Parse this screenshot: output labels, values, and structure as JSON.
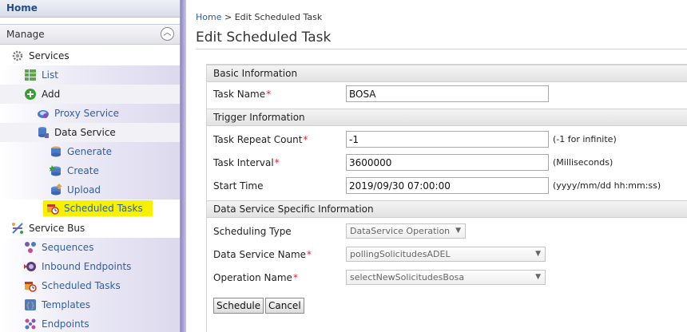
{
  "sidebar": {
    "home": "Home",
    "manage": "Manage",
    "collapse_glyph": "︿",
    "items": [
      {
        "label": "Services",
        "icon": "gear-icon"
      },
      {
        "label": "List",
        "icon": "list-grid-icon"
      },
      {
        "label": "Add",
        "icon": "plus-circle-icon"
      },
      {
        "label": "Proxy Service",
        "icon": "proxy-service-icon"
      },
      {
        "label": "Data Service",
        "icon": "database-icon"
      },
      {
        "label": "Generate",
        "icon": "generate-icon"
      },
      {
        "label": "Create",
        "icon": "create-icon"
      },
      {
        "label": "Upload",
        "icon": "upload-icon"
      },
      {
        "label": "Scheduled Tasks",
        "icon": "scheduled-task-icon"
      },
      {
        "label": "Service Bus",
        "icon": "service-bus-icon"
      },
      {
        "label": "Sequences",
        "icon": "sequences-icon"
      },
      {
        "label": "Inbound Endpoints",
        "icon": "inbound-endpoint-icon"
      },
      {
        "label": "Scheduled Tasks",
        "icon": "scheduled-task-icon"
      },
      {
        "label": "Templates",
        "icon": "templates-icon"
      },
      {
        "label": "Endpoints",
        "icon": "endpoints-icon"
      }
    ]
  },
  "breadcrumb": {
    "home": "Home",
    "separator": " > ",
    "current": "Edit Scheduled Task"
  },
  "page_title": "Edit Scheduled Task",
  "sections": {
    "basic": "Basic Information",
    "trigger": "Trigger Information",
    "ds": "Data Service Specific Information"
  },
  "fields": {
    "task_name": {
      "label": "Task Name",
      "required": "*",
      "value": "BOSA"
    },
    "repeat_count": {
      "label": "Task Repeat Count",
      "required": "*",
      "value": "-1",
      "hint": "(-1 for infinite)"
    },
    "interval": {
      "label": "Task Interval",
      "required": "*",
      "value": "3600000",
      "hint": "(Milliseconds)"
    },
    "start_time": {
      "label": "Start Time",
      "value": "2019/09/30 07:00:00",
      "hint": "(yyyy/mm/dd hh:mm:ss)"
    },
    "scheduling_type": {
      "label": "Scheduling Type",
      "value": "DataService Operation"
    },
    "ds_name": {
      "label": "Data Service Name",
      "required": "*",
      "value": "pollingSolicitudesADEL"
    },
    "op_name": {
      "label": "Operation Name",
      "required": "*",
      "value": "selectNewSolicitudesBosa"
    }
  },
  "buttons": {
    "schedule": "Schedule",
    "cancel": "Cancel"
  },
  "colors": {
    "link": "#2c5fa8",
    "highlight": "#f7f100",
    "required": "#dd2233",
    "sidebar_stripe": "#8e86c2"
  }
}
